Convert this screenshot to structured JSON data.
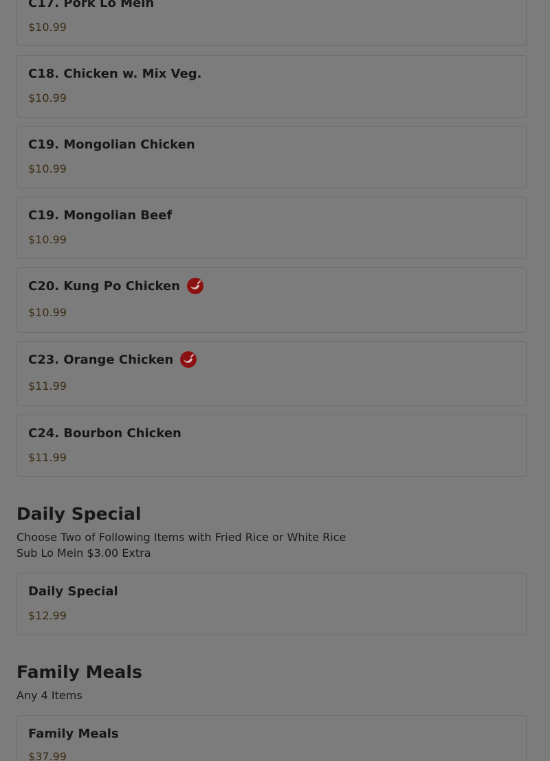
{
  "colors": {
    "overlay_background": "#7c7c7c",
    "card_border": "#6b6b6b",
    "text": "#171717",
    "price_text": "#3a2a12",
    "spicy_icon": "#8a1212"
  },
  "items": [
    {
      "name": "C17. Pork Lo Mein",
      "price": "$10.99",
      "spicy": false
    },
    {
      "name": "C18. Chicken w. Mix Veg.",
      "price": "$10.99",
      "spicy": false
    },
    {
      "name": "C19. Mongolian Chicken",
      "price": "$10.99",
      "spicy": false
    },
    {
      "name": "C19. Mongolian Beef",
      "price": "$10.99",
      "spicy": false
    },
    {
      "name": "C20. Kung Po Chicken",
      "price": "$10.99",
      "spicy": true,
      "icon": "chili-pepper-icon"
    },
    {
      "name": "C23. Orange Chicken",
      "price": "$11.99",
      "spicy": true,
      "icon": "chili-pepper-icon"
    },
    {
      "name": "C24. Bourbon Chicken",
      "price": "$11.99",
      "spicy": false
    }
  ],
  "daily_special": {
    "title": "Daily Special",
    "desc_line1": "Choose Two of Following Items with Fried Rice or White Rice",
    "desc_line2": "Sub Lo Mein $3.00 Extra",
    "item": {
      "name": "Daily Special",
      "price": "$12.99"
    }
  },
  "family_meals": {
    "title": "Family Meals",
    "desc": "Any 4 Items",
    "item": {
      "name": "Family Meals",
      "price": "$37.99"
    }
  }
}
